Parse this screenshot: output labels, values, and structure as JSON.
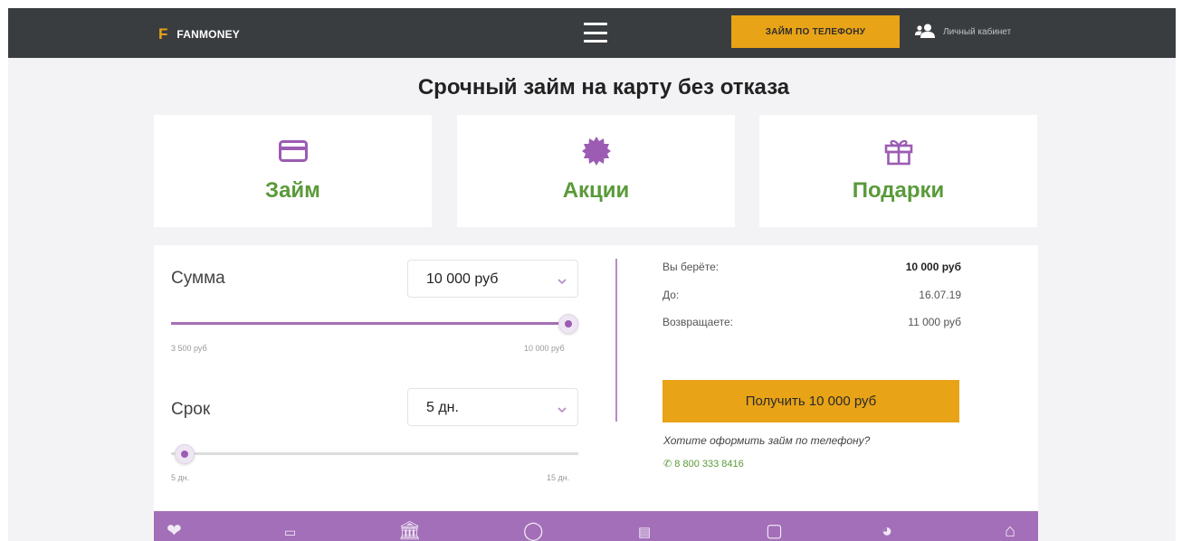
{
  "header": {
    "logo_mark": "F",
    "logo_text": "FANMONEY",
    "phone_loan_button": "ЗАЙМ ПО ТЕЛЕФОНУ",
    "cabinet_label": "Личный кабинет"
  },
  "main": {
    "title": "Срочный займ на карту без отказа",
    "cards": [
      {
        "label": "Займ",
        "icon": "credit-card-icon"
      },
      {
        "label": "Акции",
        "icon": "badge-icon"
      },
      {
        "label": "Подарки",
        "icon": "gift-icon"
      }
    ]
  },
  "calculator": {
    "amount": {
      "label": "Сумма",
      "value": "10 000 руб",
      "min_label": "3 500 руб",
      "max_label": "10 000 руб",
      "slider_fraction": 1.0
    },
    "term": {
      "label": "Срок",
      "value": "5 дн.",
      "min_label": "5 дн.",
      "max_label": "15 дн.",
      "slider_fraction": 0.0
    },
    "summary": {
      "borrow_label": "Вы берёте:",
      "borrow_value": "10 000 руб",
      "until_label": "До:",
      "until_value": "16.07.19",
      "return_label": "Возвращаете:",
      "return_value": "11 000 руб"
    },
    "get_button": "Получить 10 000 руб",
    "phone_question": "Хотите оформить займ по телефону?",
    "phone_number": "8 800 333 8416"
  },
  "colors": {
    "accent_yellow": "#e8a317",
    "brand_purple": "#a36fb8",
    "label_green": "#5a9a3a",
    "header_dark": "#3a3d40"
  }
}
